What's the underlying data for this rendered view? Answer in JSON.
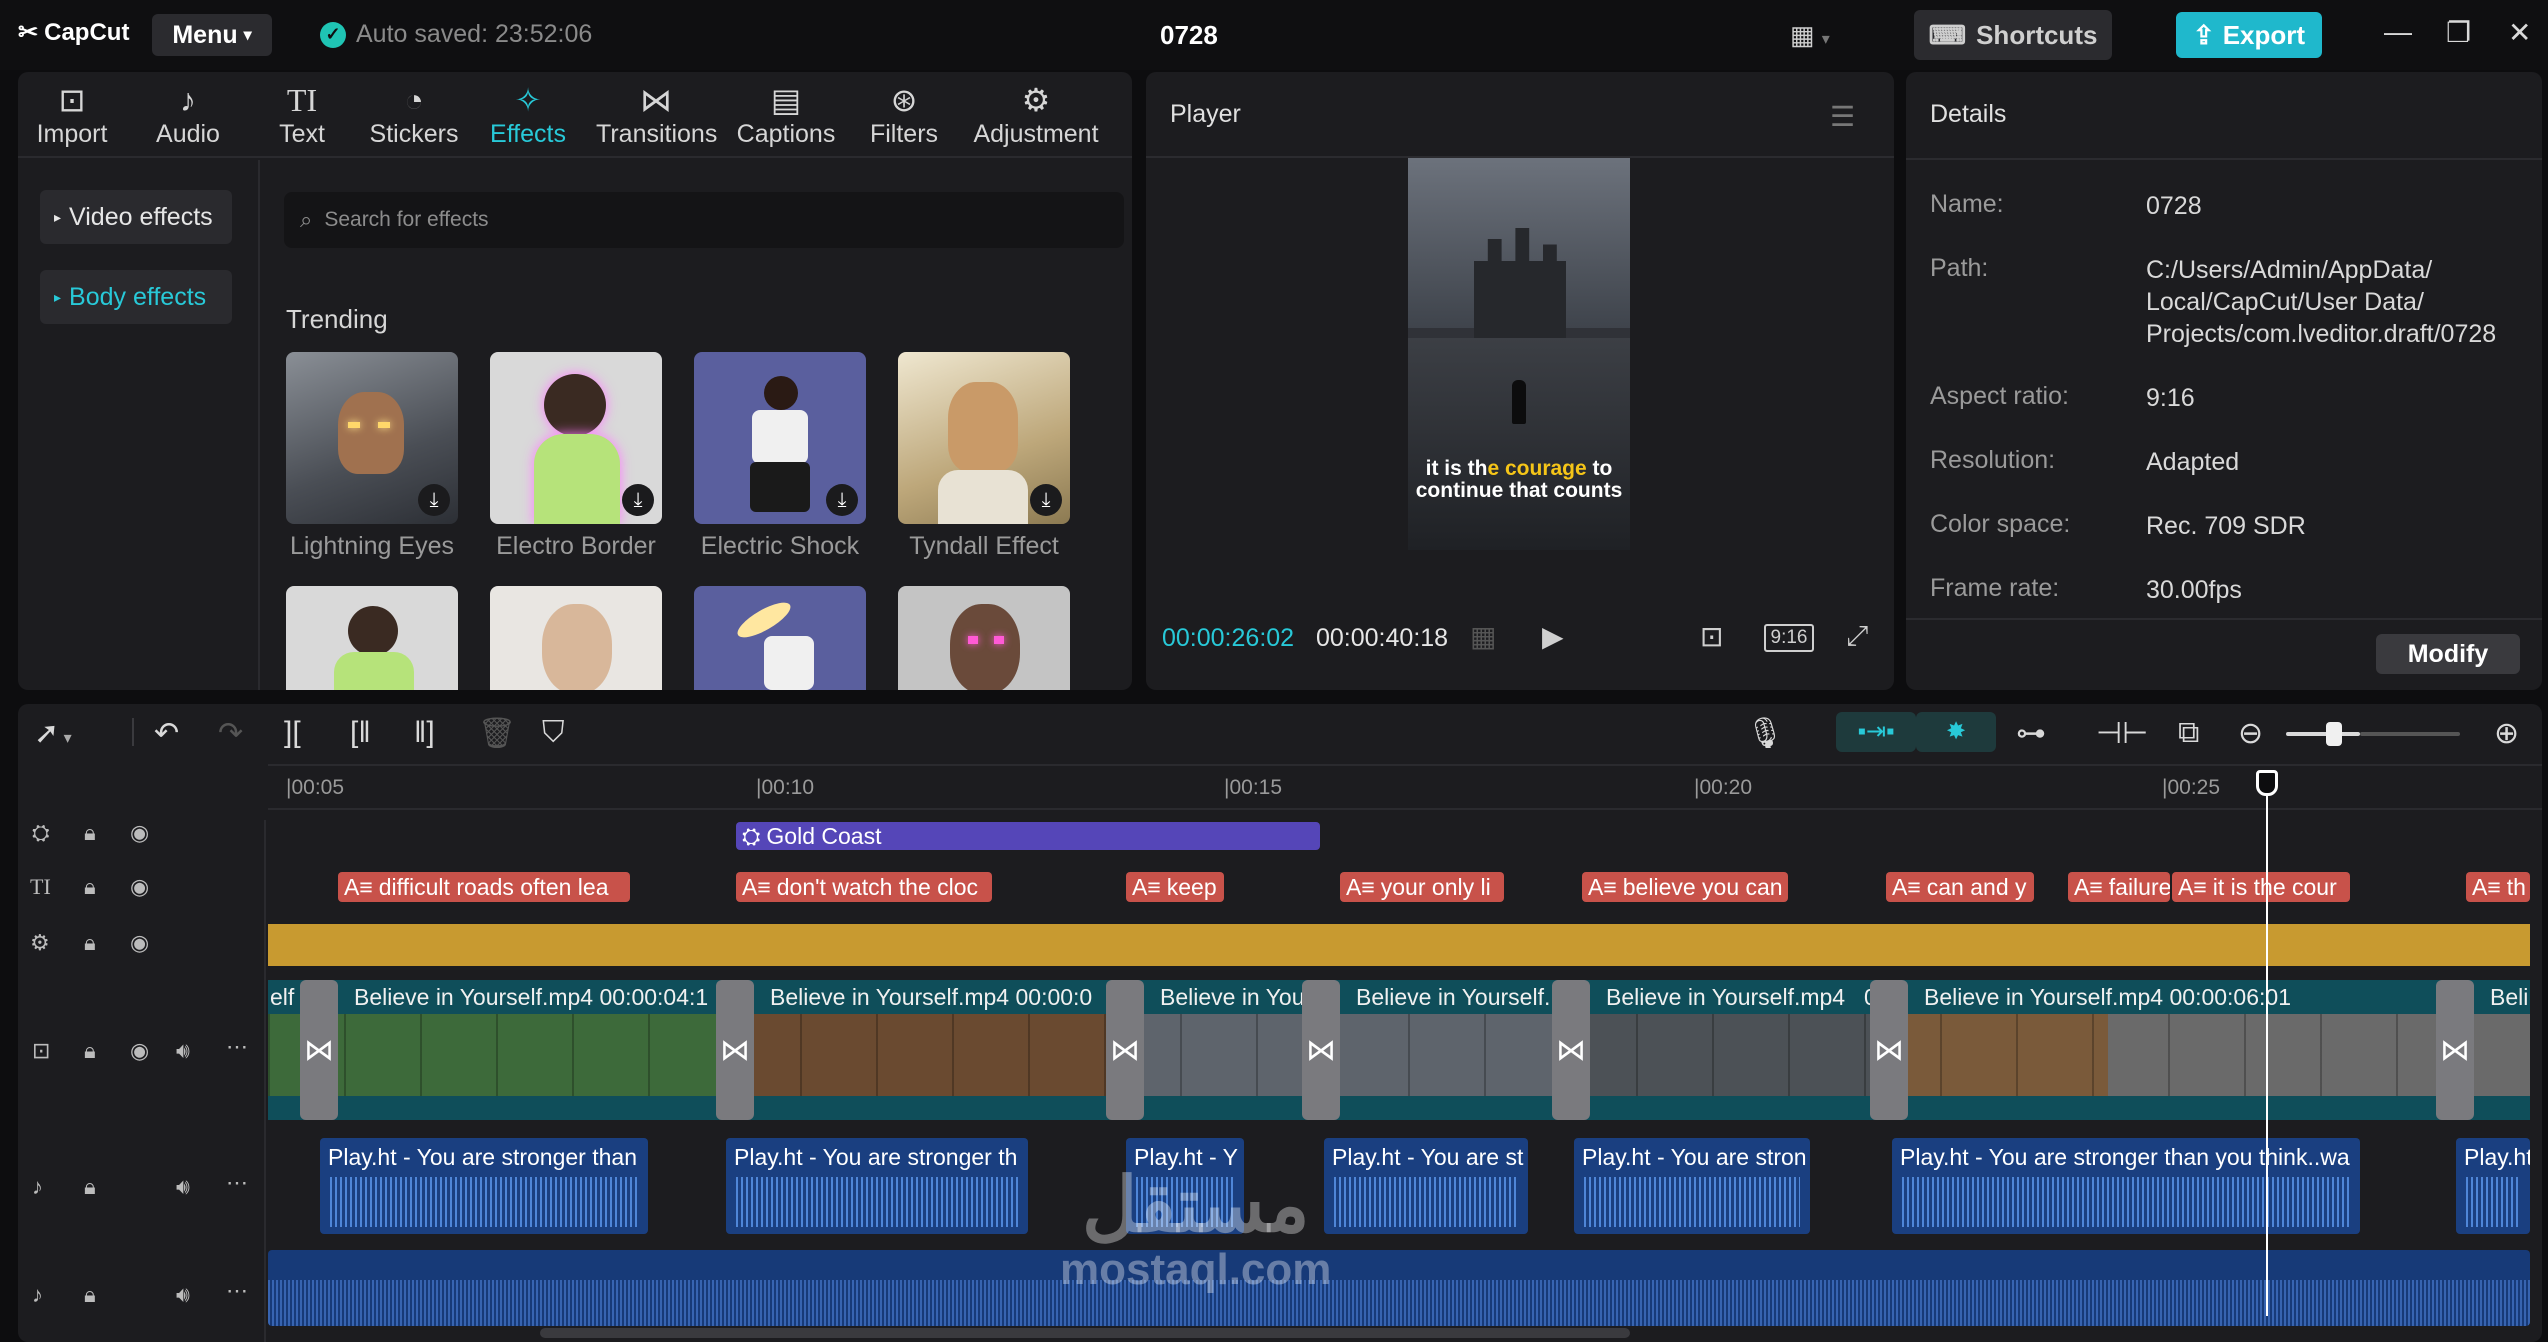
{
  "app": {
    "logo": "CapCut",
    "menu_label": "Menu",
    "autosave": "Auto saved: 23:52:06",
    "project_title": "0728"
  },
  "topbar": {
    "shortcuts_label": "Shortcuts",
    "export_label": "Export"
  },
  "toolbar": {
    "items": [
      {
        "label": "Import",
        "icon": "import-icon"
      },
      {
        "label": "Audio",
        "icon": "audio-icon"
      },
      {
        "label": "Text",
        "icon": "text-icon"
      },
      {
        "label": "Stickers",
        "icon": "stickers-icon"
      },
      {
        "label": "Effects",
        "icon": "effects-icon",
        "active": true
      },
      {
        "label": "Transitions",
        "icon": "transitions-icon"
      },
      {
        "label": "Captions",
        "icon": "captions-icon"
      },
      {
        "label": "Filters",
        "icon": "filters-icon"
      },
      {
        "label": "Adjustment",
        "icon": "adjustment-icon"
      }
    ]
  },
  "sidebar": {
    "items": [
      {
        "label": "Video effects"
      },
      {
        "label": "Body effects",
        "active": true
      }
    ]
  },
  "effects": {
    "search_placeholder": "Search for effects",
    "section_title": "Trending",
    "items": [
      {
        "label": "Lightning Eyes"
      },
      {
        "label": "Electro Border"
      },
      {
        "label": "Electric Shock"
      },
      {
        "label": "Tyndall Effect"
      }
    ]
  },
  "player": {
    "title": "Player",
    "subtitle_pre": "it is th",
    "subtitle_highlight": "e courage",
    "subtitle_post": " to continue that counts",
    "current_time": "00:00:26:02",
    "total_time": "00:00:40:18",
    "ratio_label": "9:16"
  },
  "details": {
    "title": "Details",
    "fields": [
      {
        "key": "Name:",
        "value": "0728"
      },
      {
        "key": "Path:",
        "value": "C:/Users/Admin/AppData/ Local/CapCut/User Data/ Projects/com.lveditor.draft/0728"
      },
      {
        "key": "Aspect ratio:",
        "value": "9:16"
      },
      {
        "key": "Resolution:",
        "value": "Adapted"
      },
      {
        "key": "Color space:",
        "value": "Rec. 709 SDR"
      },
      {
        "key": "Frame rate:",
        "value": "30.00fps"
      }
    ],
    "modify_label": "Modify"
  },
  "timeline": {
    "ruler": [
      "|00:05",
      "|00:10",
      "|00:15",
      "|00:20",
      "|00:25"
    ],
    "effect_clip": "Gold Coast",
    "text_clips": [
      "difficult roads often lea",
      "don't watch the cloc",
      "keep",
      "your only li",
      "believe you can",
      "can and y",
      "failure",
      "it is the cour",
      "th"
    ],
    "video_clips": [
      "elf",
      "Believe in Yourself.mp4  00:00:04:1",
      "Believe in Yourself.mp4  00:00:0",
      "Believe in You",
      "Believe in Yourself.",
      "Believe in Yourself.mp4",
      "0",
      "Believe in Yourself.mp4  00:00:06:01",
      "Beli"
    ],
    "audio_clips": [
      "Play.ht - You are stronger than",
      "Play.ht - You are stronger th",
      "Play.ht - Y",
      "Play.ht - You are st",
      "Play.ht - You are stron",
      "Play.ht - You are stronger than you think..wa",
      "Play.ht"
    ]
  },
  "watermark": {
    "arabic": "مستقل",
    "latin": "mostaql.com"
  },
  "colors": {
    "accent": "#28c9d8",
    "export": "#1fb8cc",
    "text_clip": "#c8524a",
    "effect_clip": "#5546b8",
    "adjust_track": "#c89a30",
    "video_track": "#0f4e5a",
    "audio_clip": "#1a3f80"
  }
}
